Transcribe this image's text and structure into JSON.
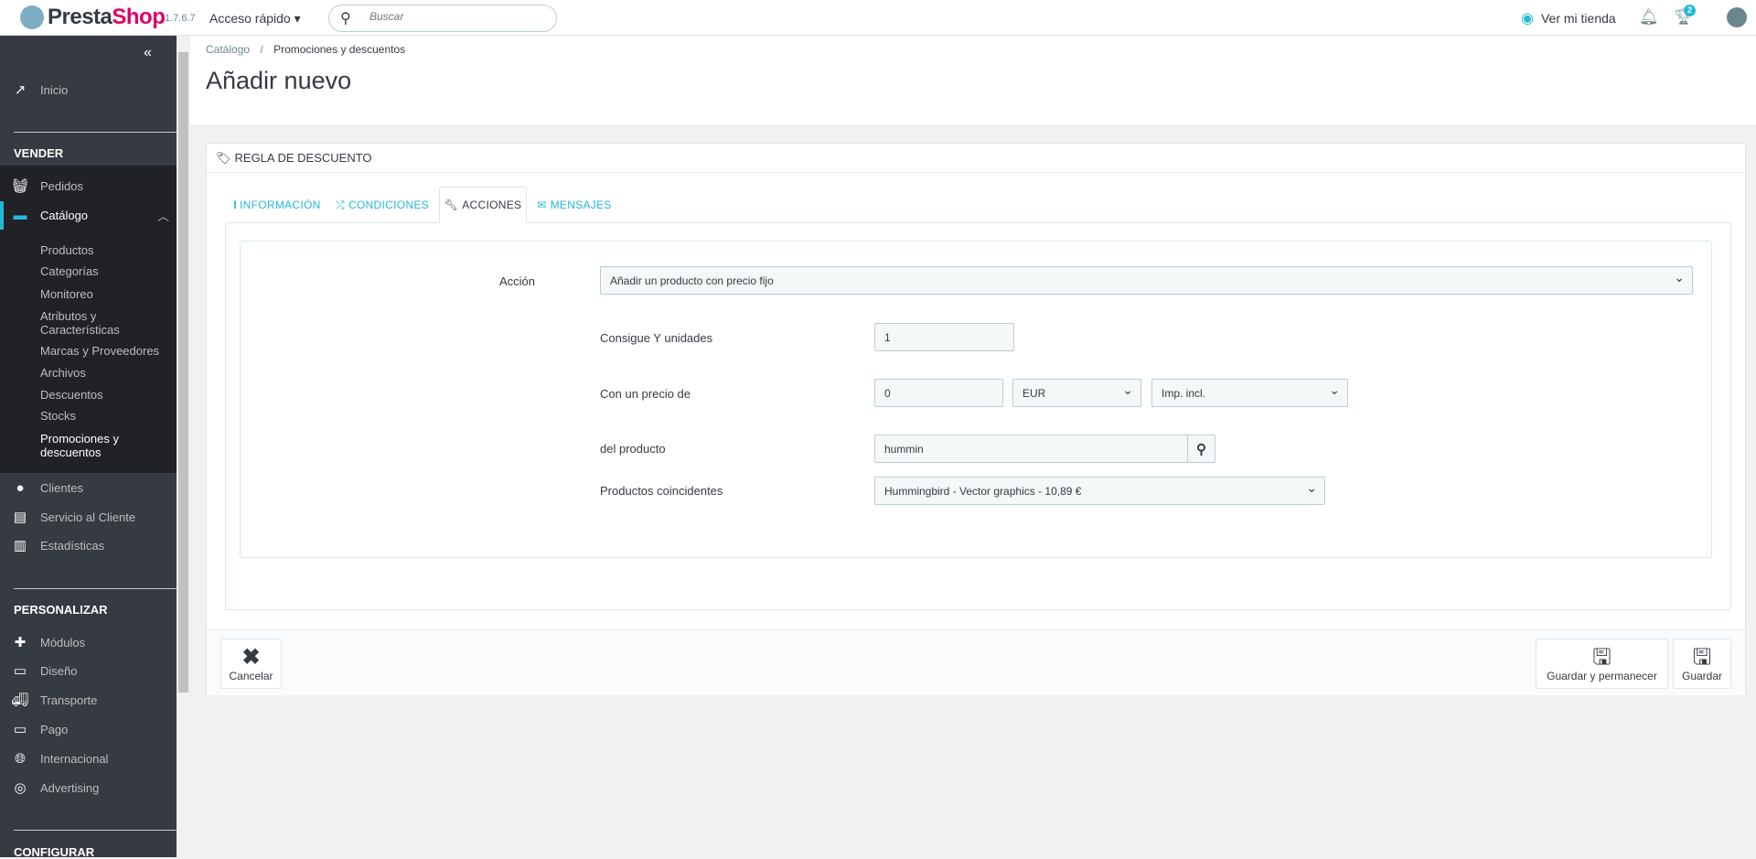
{
  "topbar": {
    "brand_a": "Presta",
    "brand_b": "Shop",
    "version": "1.7.6.7",
    "quick_access": "Acceso rápido",
    "search_placeholder": "Buscar",
    "view_store": "Ver mi tienda",
    "notif_count": "2"
  },
  "sidebar": {
    "home": "Inicio",
    "sections": {
      "sell": "VENDER",
      "customize": "PERSONALIZAR",
      "configure": "CONFIGURAR"
    },
    "orders": "Pedidos",
    "catalog": "Catálogo",
    "catalog_sub": [
      "Productos",
      "Categorías",
      "Monitoreo",
      "Atributos y Características",
      "Marcas y Proveedores",
      "Archivos",
      "Descuentos",
      "Stocks",
      "Promociones y descuentos"
    ],
    "customers": "Clientes",
    "service": "Servicio al Cliente",
    "stats": "Estadísticas",
    "modules": "Módulos",
    "design": "Diseño",
    "shipping": "Transporte",
    "payment": "Pago",
    "international": "Internacional",
    "advertising": "Advertising"
  },
  "breadcrumb": {
    "parent": "Catálogo",
    "current": "Promociones y descuentos"
  },
  "page_title": "Añadir nuevo",
  "panel": {
    "heading": "REGLA DE DESCUENTO",
    "tabs": [
      {
        "label": "INFORMACIÓN"
      },
      {
        "label": "CONDICIONES"
      },
      {
        "label": "ACCIONES"
      },
      {
        "label": "MENSAJES"
      }
    ],
    "form": {
      "action_label": "Acción",
      "action_value": "Añadir un producto con precio fijo",
      "units_label": "Consigue Y unidades",
      "units_value": "1",
      "price_label": "Con un precio de",
      "price_value": "0",
      "currency": "EUR",
      "tax": "Imp. incl.",
      "product_label": "del producto",
      "product_value": "hummin",
      "matching_label": "Productos coincidentes",
      "matching_value": "Hummingbird - Vector graphics - 10,89 €"
    }
  },
  "footer": {
    "cancel": "Cancelar",
    "save_stay": "Guardar y permanecer",
    "save": "Guardar"
  },
  "colors": {
    "accent": "#25b9d7",
    "sidebar": "#363a41",
    "brand": "#df0067"
  }
}
